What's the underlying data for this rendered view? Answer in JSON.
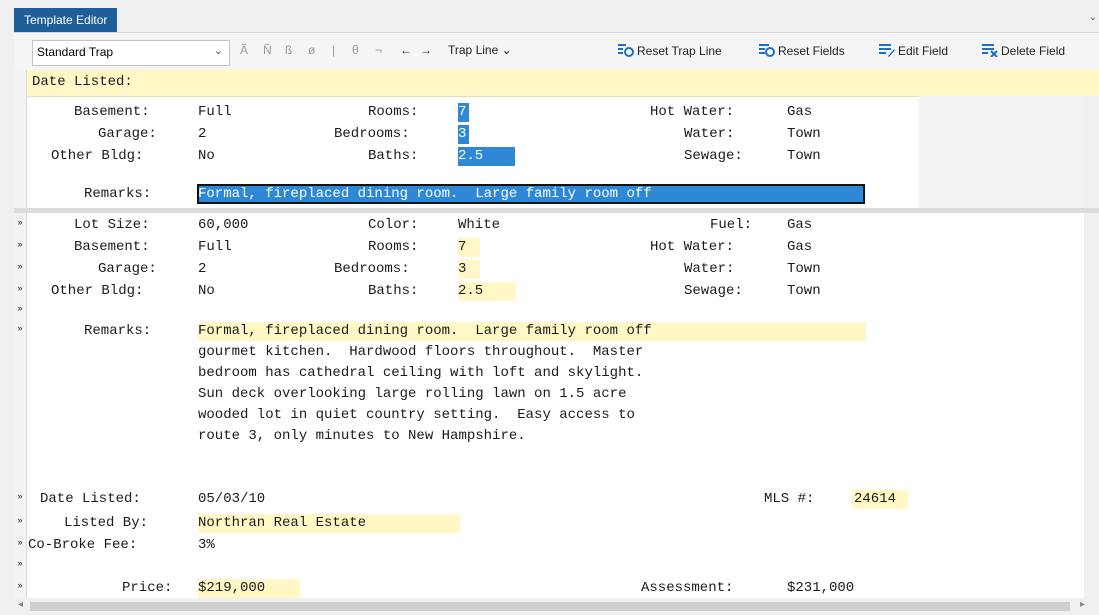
{
  "tab": {
    "title": "Template Editor"
  },
  "toolbar": {
    "template_select": "Standard Trap",
    "char_a": "Ã",
    "char_n": "Ñ",
    "char_b": "ß",
    "char_o": "ø",
    "sep": "|",
    "char_theta": "θ",
    "char_not": "¬",
    "arrow_left": "←",
    "arrow_right": "→",
    "trap_line": "Trap Line",
    "reset_trap_line": "Reset Trap Line",
    "reset_fields": "Reset Fields",
    "edit_field": "Edit Field",
    "delete_field": "Delete Field"
  },
  "header": {
    "label": "Date Listed:"
  },
  "template": {
    "basement_label": "Basement:",
    "basement": "Full",
    "rooms_label": "Rooms:",
    "rooms": "7",
    "hotwater_label": "Hot Water:",
    "hotwater": "Gas",
    "garage_label": "Garage:",
    "garage": "2",
    "bedrooms_label": "Bedrooms:",
    "bedrooms": "3",
    "water_label": "Water:",
    "water": "Town",
    "otherbldg_label": "Other Bldg:",
    "otherbldg": "No",
    "baths_label": "Baths:",
    "baths": "2.5",
    "sewage_label": "Sewage:",
    "sewage": "Town",
    "remarks_label": "Remarks:",
    "remarks": "Formal, fireplaced dining room.  Large family room off"
  },
  "report": {
    "lotsize_label": "Lot Size:",
    "lotsize": "60,000",
    "color_label": "Color:",
    "color": "White",
    "fuel_label": "Fuel:",
    "fuel": "Gas",
    "basement_label": "Basement:",
    "basement": "Full",
    "rooms_label": "Rooms:",
    "rooms": "7",
    "hotwater_label": "Hot Water:",
    "hotwater": "Gas",
    "garage_label": "Garage:",
    "garage": "2",
    "bedrooms_label": "Bedrooms:",
    "bedrooms": "3",
    "water_label": "Water:",
    "water": "Town",
    "otherbldg_label": "Other Bldg:",
    "otherbldg": "No",
    "baths_label": "Baths:",
    "baths": "2.5",
    "sewage_label": "Sewage:",
    "sewage": "Town",
    "remarks_label": "Remarks:",
    "remarks_lines": [
      "Formal, fireplaced dining room.  Large family room off",
      "gourmet kitchen.  Hardwood floors throughout.  Master",
      "bedroom has cathedral ceiling with loft and skylight.",
      "Sun deck overlooking large rolling lawn on 1.5 acre",
      "wooded lot in quiet country setting.  Easy access to",
      "route 3, only minutes to New Hampshire."
    ],
    "datelisted_label": "Date Listed:",
    "datelisted": "05/03/10",
    "mls_label": "MLS #:",
    "mls": "24614",
    "listedby_label": "Listed By:",
    "listedby": "Northran Real Estate",
    "cobroke_label": "Co-Broke Fee:",
    "cobroke": "3%",
    "price_label": "Price:",
    "price": "$219,000",
    "assessment_label": "Assessment:",
    "assessment": "$231,000"
  },
  "gutter_mark": "»",
  "colors": {
    "accent": "#1f5f99",
    "selection": "#2e88d6",
    "highlight": "#fff8c6"
  }
}
